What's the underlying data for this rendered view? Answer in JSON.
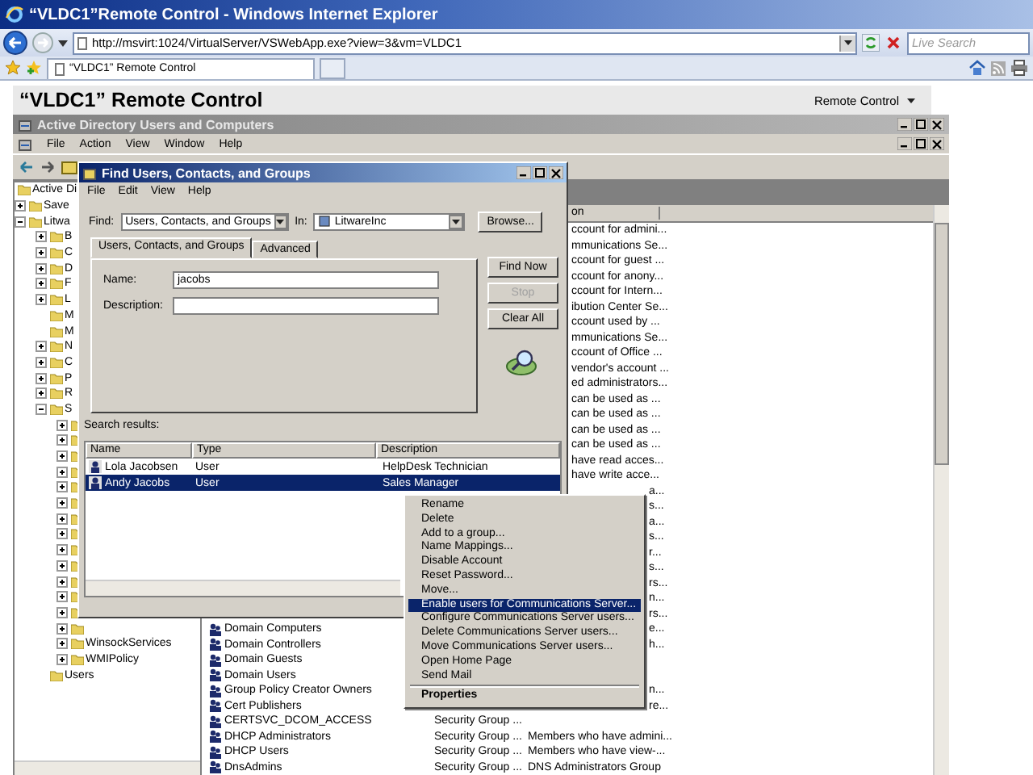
{
  "browser": {
    "title": "“VLDC1”Remote Control - Windows Internet Explorer",
    "address": "http://msvirt:1024/VirtualServer/VSWebApp.exe?view=3&vm=VLDC1",
    "search": {
      "placeholder": "Live Search"
    },
    "tabs": [
      {
        "label": "“VLDC1” Remote Control",
        "selected": true
      }
    ]
  },
  "page": {
    "heading": "“VLDC1” Remote Control",
    "menu": "Remote Control"
  },
  "mmc": {
    "title": "Active Directory Users and Computers",
    "menu": [
      "File",
      "Action",
      "View",
      "Window",
      "Help"
    ],
    "tree": [
      {
        "label": "Active Di",
        "children": [
          {
            "label": "Save",
            "expanded": false
          },
          {
            "label": "Litwa",
            "expanded": true,
            "children": [
              {
                "label": "B",
                "expanded": false
              },
              {
                "label": "C",
                "expanded": false
              },
              {
                "label": "D",
                "expanded": false
              },
              {
                "label": "F",
                "expanded": false
              },
              {
                "label": "L",
                "expanded": false
              },
              {
                "label": "M"
              },
              {
                "label": "M"
              },
              {
                "label": "N",
                "expanded": false
              },
              {
                "label": "C",
                "expanded": false
              },
              {
                "label": "P",
                "expanded": false
              },
              {
                "label": "R",
                "expanded": false
              },
              {
                "label": "S",
                "expanded": true,
                "children": [
                  {
                    "expanded": false
                  },
                  {
                    "expanded": false
                  },
                  {
                    "expanded": false
                  },
                  {
                    "expanded": false
                  },
                  {
                    "expanded": false
                  },
                  {
                    "expanded": false
                  },
                  {
                    "expanded": false
                  },
                  {
                    "expanded": false
                  },
                  {
                    "expanded": false
                  },
                  {
                    "expanded": false
                  },
                  {
                    "expanded": false
                  },
                  {
                    "expanded": false
                  },
                  {
                    "expanded": false
                  },
                  {
                    "expanded": false
                  },
                  {
                    "label": "WinsockServices",
                    "expanded": false
                  },
                  {
                    "label": "WMIPolicy",
                    "expanded": false
                  }
                ]
              },
              {
                "label": "Users"
              }
            ]
          }
        ]
      }
    ],
    "list_header": "on",
    "rows": [
      {
        "kind": "past-dialog",
        "description": "ccount for admini..."
      },
      {
        "kind": "past-dialog",
        "description": "mmunications Se..."
      },
      {
        "kind": "past-dialog",
        "description": "ccount for guest ..."
      },
      {
        "kind": "past-dialog",
        "description": "ccount for anony..."
      },
      {
        "kind": "past-dialog",
        "description": "ccount for Intern..."
      },
      {
        "kind": "past-dialog",
        "description": "ibution Center Se..."
      },
      {
        "kind": "past-dialog",
        "description": "ccount used by ..."
      },
      {
        "kind": "past-dialog",
        "description": "mmunications Se..."
      },
      {
        "kind": "past-dialog",
        "description": "ccount of Office ..."
      },
      {
        "kind": "past-dialog",
        "description": "vendor's account ..."
      },
      {
        "kind": "past-dialog",
        "description": "ed administrators..."
      },
      {
        "kind": "past-dialog",
        "description": "can be used as ..."
      },
      {
        "kind": "past-dialog",
        "description": "can be used as ..."
      },
      {
        "kind": "past-dialog",
        "description": "can be used as ..."
      },
      {
        "kind": "past-dialog",
        "description": "can be used as ..."
      },
      {
        "kind": "past-dialog",
        "description": "have read acces..."
      },
      {
        "kind": "past-dialog",
        "description": "have write acce..."
      },
      {
        "kind": "past-menu",
        "description": "a..."
      },
      {
        "kind": "past-menu",
        "description": "s..."
      },
      {
        "kind": "past-menu",
        "description": "a..."
      },
      {
        "kind": "past-menu",
        "description": "s..."
      },
      {
        "kind": "past-menu",
        "description": "r..."
      },
      {
        "kind": "past-menu",
        "description": "s..."
      },
      {
        "kind": "past-menu",
        "description": "rs..."
      },
      {
        "kind": "past-menu",
        "description": "n..."
      },
      {
        "kind": "past-menu",
        "description": "rs..."
      },
      {
        "kind": "beside-menu",
        "name": "Domain Computers",
        "description": "e..."
      },
      {
        "kind": "beside-menu",
        "name": "Domain Controllers",
        "description": "h..."
      },
      {
        "kind": "beside-menu",
        "name": "Domain Guests"
      },
      {
        "kind": "beside-menu",
        "name": "Domain Users"
      },
      {
        "kind": "beside-menu",
        "name": "Group Policy Creator Owners",
        "description": "n..."
      },
      {
        "kind": "beside-menu",
        "name": "Cert Publishers",
        "description": "re..."
      },
      {
        "kind": "full",
        "name": "CERTSVC_DCOM_ACCESS",
        "type": "Security Group ..."
      },
      {
        "kind": "full",
        "name": "DHCP Administrators",
        "type": "Security Group ...",
        "description": "Members who have admini..."
      },
      {
        "kind": "full",
        "name": "DHCP Users",
        "type": "Security Group ...",
        "description": "Members who have view-..."
      },
      {
        "kind": "full",
        "name": "DnsAdmins",
        "type": "Security Group ...",
        "description": "DNS Administrators Group"
      }
    ]
  },
  "find_dialog": {
    "title": "Find Users, Contacts, and Groups",
    "menu": [
      "File",
      "Edit",
      "View",
      "Help"
    ],
    "find_label": "Find:",
    "find_value": "Users, Contacts, and Groups",
    "in_label": "In:",
    "in_value": "LitwareInc",
    "browse": "Browse...",
    "tabs": [
      {
        "label": "Users, Contacts, and Groups",
        "selected": true
      },
      {
        "label": "Advanced",
        "selected": false
      }
    ],
    "fields": [
      {
        "label": "Name:",
        "value": "jacobs"
      },
      {
        "label": "Description:"
      }
    ],
    "buttons": [
      {
        "label": "Find Now",
        "disabled": false
      },
      {
        "label": "Stop",
        "disabled": true
      },
      {
        "label": "Clear All",
        "disabled": false
      }
    ],
    "results_label": "Search results:",
    "results": {
      "columns": [
        "Name",
        "Type",
        "Description"
      ],
      "rows": [
        {
          "name": "Lola Jacobsen",
          "type": "User",
          "description": "HelpDesk Technician",
          "selected": false
        },
        {
          "name": "Andy Jacobs",
          "type": "User",
          "description": "Sales Manager",
          "selected": true
        }
      ]
    }
  },
  "context_menu": [
    {
      "kind": "item",
      "label": "Rename",
      "selected": false
    },
    {
      "kind": "item",
      "label": "Delete",
      "selected": false
    },
    {
      "kind": "item",
      "label": "Add to a group...",
      "selected": false
    },
    {
      "kind": "item",
      "label": "Name Mappings...",
      "selected": false
    },
    {
      "kind": "item",
      "label": "Disable Account",
      "selected": false
    },
    {
      "kind": "item",
      "label": "Reset Password...",
      "selected": false
    },
    {
      "kind": "item",
      "label": "Move...",
      "selected": false
    },
    {
      "kind": "item",
      "label": "Enable users for Communications Server...",
      "selected": true
    },
    {
      "kind": "item",
      "label": "Configure Communications Server users...",
      "selected": false
    },
    {
      "kind": "item",
      "label": "Delete Communications Server users...",
      "selected": false
    },
    {
      "kind": "item",
      "label": "Move Communications Server users...",
      "selected": false
    },
    {
      "kind": "item",
      "label": "Open Home Page",
      "selected": false
    },
    {
      "kind": "item",
      "label": "Send Mail",
      "selected": false
    },
    {
      "kind": "separator"
    },
    {
      "kind": "default",
      "label": "Properties",
      "selected": false
    }
  ]
}
